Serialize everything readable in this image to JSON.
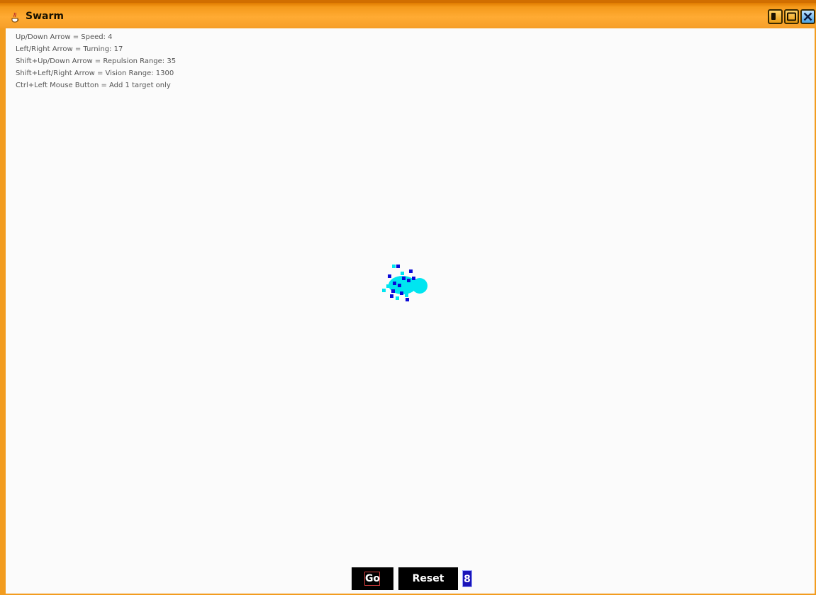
{
  "window": {
    "title": "Swarm",
    "icon": "java-cup-icon",
    "accent_color": "#f29c1f",
    "controls": [
      "minimize-icon",
      "maximize-icon",
      "close-icon"
    ]
  },
  "info_lines": [
    "Up/Down Arrow = Speed: 4",
    "Left/Right Arrow = Turning: 17",
    "Shift+Up/Down Arrow = Repulsion Range: 35",
    "Shift+Left/Right Arrow = Vision Range: 1300",
    "Ctrl+Left Mouse Button = Add 1 target only"
  ],
  "simulation": {
    "agent_colors": [
      "#00e5f0",
      "#0a0ad8"
    ],
    "target_color": "#00e5f0"
  },
  "controls": {
    "go_label": "Go",
    "reset_label": "Reset",
    "count_value": "8"
  }
}
